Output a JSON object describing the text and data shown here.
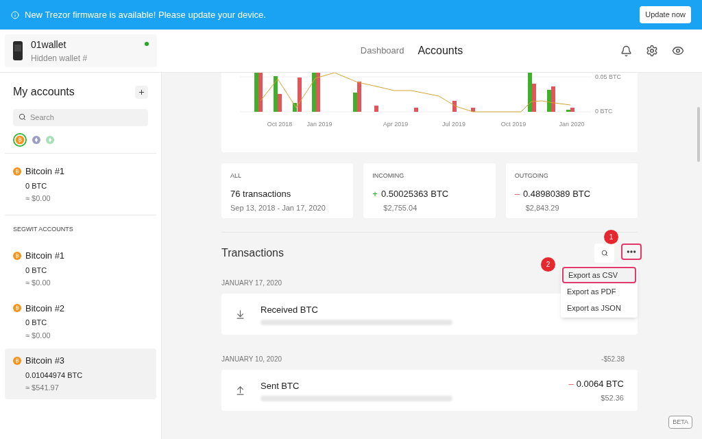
{
  "banner": {
    "text": "New Trezor firmware is available! Please update your device.",
    "button": "Update now"
  },
  "wallet": {
    "name": "01wallet",
    "subtitle": "Hidden wallet #",
    "connected": true
  },
  "nav": [
    {
      "label": "Dashboard",
      "selected": false
    },
    {
      "label": "Accounts",
      "selected": true
    }
  ],
  "sidebar": {
    "title": "My accounts",
    "search_placeholder": "Search",
    "coins": [
      {
        "kind": "btc",
        "selected": true
      },
      {
        "kind": "eth",
        "selected": false
      },
      {
        "kind": "etc",
        "selected": false
      }
    ],
    "sections": [
      {
        "accounts": [
          {
            "name": "Bitcoin #1",
            "balance": "0 BTC",
            "fiat": "≈ $0.00",
            "selected": false
          }
        ]
      },
      {
        "label": "SEGWIT ACCOUNTS",
        "accounts": [
          {
            "name": "Bitcoin #1",
            "balance": "0 BTC",
            "fiat": "≈ $0.00",
            "selected": false
          },
          {
            "name": "Bitcoin #2",
            "balance": "0 BTC",
            "fiat": "≈ $0.00",
            "selected": false
          },
          {
            "name": "Bitcoin #3",
            "balance": "0.01044974 BTC",
            "fiat": "≈ $541.97",
            "selected": true
          }
        ]
      }
    ]
  },
  "chart": {
    "y_labels": [
      "0.05 BTC",
      "0 BTC"
    ],
    "x_labels": [
      "Oct 2018",
      "Jan 2019",
      "Apr 2019",
      "Jul 2019",
      "Oct 2019",
      "Jan 2020"
    ]
  },
  "summary": [
    {
      "kind": "all",
      "title": "ALL",
      "main": "76 transactions",
      "sub": "Sep 13, 2018 - Jan 17, 2020"
    },
    {
      "kind": "incoming",
      "title": "INCOMING",
      "sign": "+",
      "main": "0.50025363 BTC",
      "sub": "$2,755.04"
    },
    {
      "kind": "outgoing",
      "title": "OUTGOING",
      "sign": "–",
      "main": "0.48980389 BTC",
      "sub": "$2,843.29"
    }
  ],
  "transactions": {
    "title": "Transactions",
    "markers": [
      "1",
      "2"
    ],
    "menu": [
      {
        "label": "Export as CSV",
        "selected": true
      },
      {
        "label": "Export as PDF",
        "selected": false
      },
      {
        "label": "Export as JSON",
        "selected": false
      }
    ],
    "groups": [
      {
        "date": "JANUARY 17, 2020",
        "items": [
          {
            "kind": "received",
            "title": "Received BTC"
          }
        ]
      },
      {
        "date": "JANUARY 10, 2020",
        "total": "-$52.38",
        "items": [
          {
            "kind": "sent",
            "title": "Sent BTC",
            "sign": "–",
            "amount": "0.0064 BTC",
            "fiat": "$52.36"
          }
        ]
      }
    ]
  },
  "beta": "BETA"
}
